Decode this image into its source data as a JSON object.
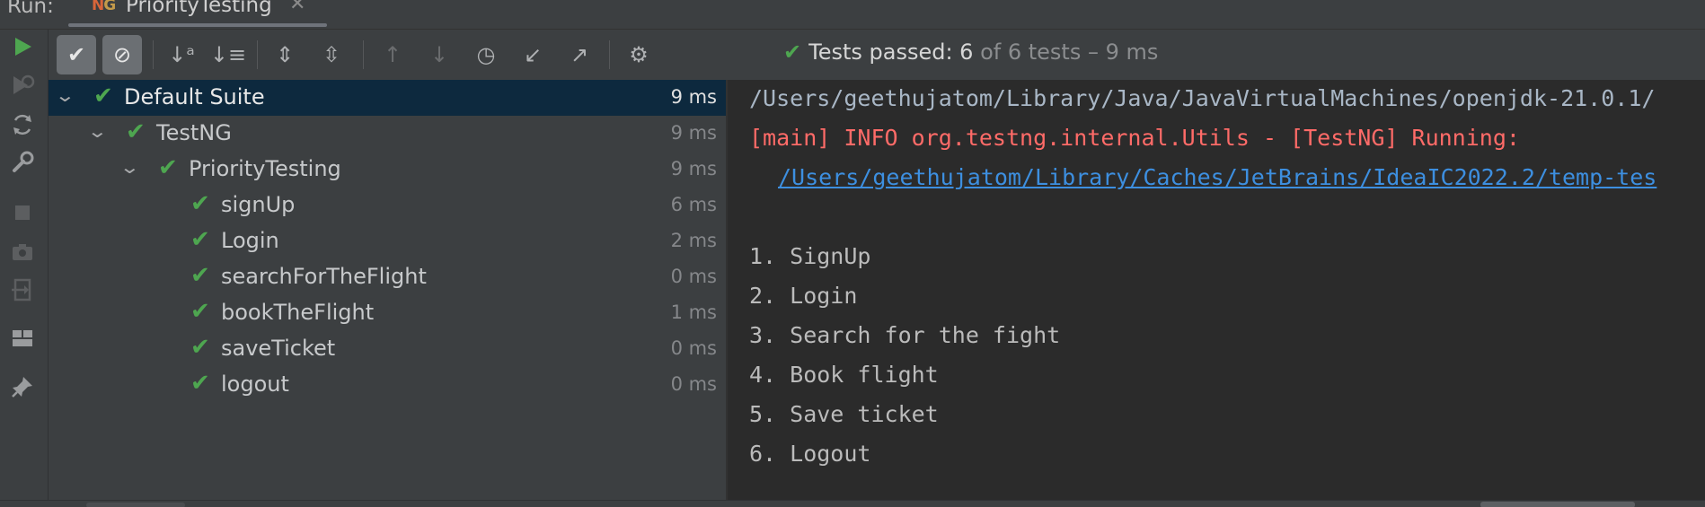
{
  "run_bar": {
    "label": "Run:",
    "tab": {
      "logo_n": "N",
      "logo_g": "G",
      "title": "PriorityTesting",
      "close_glyph": "✕"
    }
  },
  "left_strip": {
    "icons": [
      "rerun-icon",
      "rerun-failed-icon",
      "toggle-auto-test-icon",
      "wrench-icon",
      "stop-icon",
      "camera-icon",
      "exit-icon",
      "layout-icon",
      "pin-icon"
    ]
  },
  "toolbar": {
    "buttons": [
      {
        "name": "show-passed",
        "glyph": "✔"
      },
      {
        "name": "show-ignored",
        "glyph": "⊘"
      },
      {
        "name": "sort-alphabetically",
        "glyph": "↓ᵃ"
      },
      {
        "name": "sort-by-duration",
        "glyph": "↓≡"
      },
      {
        "name": "expand-all",
        "glyph": "⇕"
      },
      {
        "name": "collapse-all",
        "glyph": "⇳"
      },
      {
        "name": "previous-failed",
        "glyph": "↑"
      },
      {
        "name": "next-failed",
        "glyph": "↓"
      },
      {
        "name": "test-history",
        "glyph": "◷"
      },
      {
        "name": "import-tests",
        "glyph": "↙"
      },
      {
        "name": "export-tests",
        "glyph": "↗"
      },
      {
        "name": "settings",
        "glyph": "⚙"
      }
    ],
    "status": {
      "passed": "Tests passed: 6",
      "rest": " of 6 tests – 9 ms"
    }
  },
  "tree": [
    {
      "label": "Default Suite",
      "duration": "9 ms",
      "level": 0,
      "expanded": true,
      "selected": true
    },
    {
      "label": "TestNG",
      "duration": "9 ms",
      "level": 1,
      "expanded": true
    },
    {
      "label": "PriorityTesting",
      "duration": "9 ms",
      "level": 2,
      "expanded": true
    },
    {
      "label": "signUp",
      "duration": "6 ms",
      "level": 3
    },
    {
      "label": "Login",
      "duration": "2 ms",
      "level": 3
    },
    {
      "label": "searchForTheFlight",
      "duration": "0 ms",
      "level": 3
    },
    {
      "label": "bookTheFlight",
      "duration": "1 ms",
      "level": 3
    },
    {
      "label": "saveTicket",
      "duration": "0 ms",
      "level": 3
    },
    {
      "label": "logout",
      "duration": "0 ms",
      "level": 3
    }
  ],
  "console": {
    "java_path": "/Users/geethujatom/Library/Java/JavaVirtualMachines/openjdk-21.0.1/",
    "info_line": "[main] INFO org.testng.internal.Utils - [TestNG] Running:",
    "suite_link": "/Users/geethujatom/Library/Caches/JetBrains/IdeaIC2022.2/temp-tes",
    "output": [
      "1. SignUp",
      "2. Login",
      "3. Search for the fight",
      "4. Book flight",
      "5. Save ticket",
      "6. Logout"
    ]
  },
  "colors": {
    "passed": "#4ea650",
    "error": "#ff6b68",
    "link": "#3d8fe0",
    "selection": "#0d293e",
    "console_bg": "#2b2b2b"
  }
}
